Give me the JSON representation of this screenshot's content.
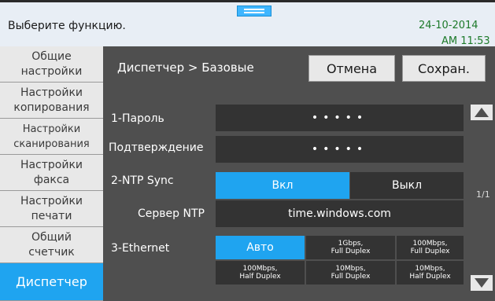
{
  "topbar": {
    "prompt": "Выберите функцию.",
    "date": "24-10-2014",
    "time": "AM 11:53"
  },
  "sidebar": {
    "items": [
      {
        "label": "Общие настройки"
      },
      {
        "label": "Настройки копирования"
      },
      {
        "label": "Настройки сканирования"
      },
      {
        "label": "Настройки факса"
      },
      {
        "label": "Настройки печати"
      },
      {
        "label": "Общий счетчик"
      },
      {
        "label": "Диспетчер"
      }
    ],
    "active_index": 6
  },
  "header": {
    "breadcrumb": "Диспетчер > Базовые",
    "cancel_label": "Отмена",
    "save_label": "Сохран."
  },
  "settings": {
    "password": {
      "label": "1-Пароль",
      "value": "•••••"
    },
    "confirm": {
      "label": "Подтверждение",
      "value": "•••••"
    },
    "ntp_sync": {
      "label": "2-NTP Sync",
      "on_label": "Вкл",
      "off_label": "Выкл",
      "selected": "Вкл"
    },
    "ntp_server": {
      "label": "Сервер NTP",
      "value": "time.windows.com"
    },
    "ethernet": {
      "label": "3-Ethernet",
      "options": [
        {
          "line1": "Авто",
          "line2": ""
        },
        {
          "line1": "1Gbps,",
          "line2": "Full Duplex"
        },
        {
          "line1": "100Mbps,",
          "line2": "Full Duplex"
        },
        {
          "line1": "100Mbps,",
          "line2": "Half Duplex"
        },
        {
          "line1": "10Mbps,",
          "line2": "Full Duplex"
        },
        {
          "line1": "10Mbps,",
          "line2": "Half Duplex"
        }
      ],
      "selected": "Авто"
    }
  },
  "pagination": {
    "page": "1/1"
  },
  "colors": {
    "accent": "#1fa4f0",
    "clock": "#1d7a2a",
    "panel": "#4f4f4f",
    "field": "#333333"
  }
}
